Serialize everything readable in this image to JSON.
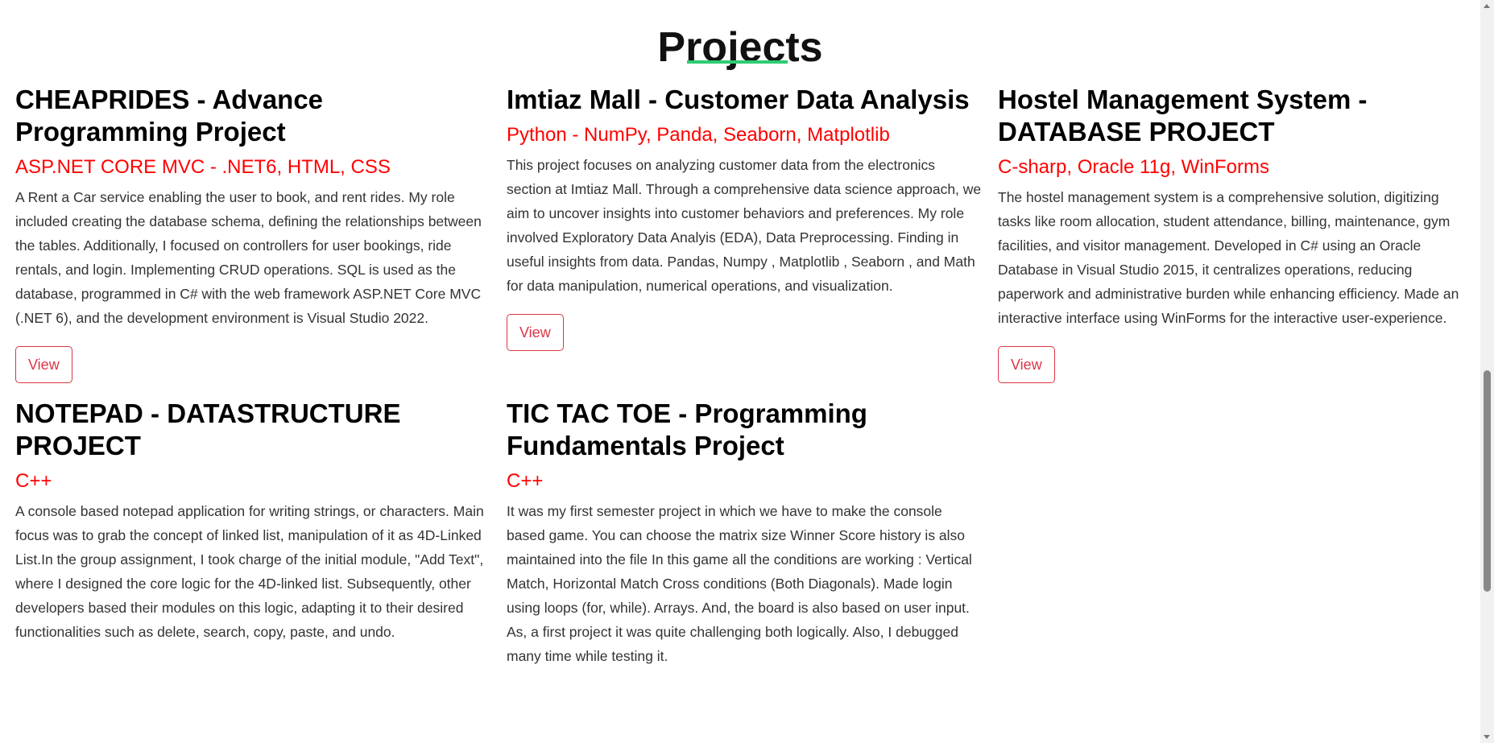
{
  "page": {
    "heading": "Projects",
    "accent_color": "#2ecc71",
    "tech_color": "#ff0000",
    "button_color": "#dc3545"
  },
  "projects": [
    {
      "title": "CHEAPRIDES - Advance Programming Project",
      "tech": "ASP.NET CORE MVC - .NET6, HTML, CSS",
      "description": "A Rent a Car service enabling the user to book, and rent rides. My role included creating the database schema, defining the relationships between the tables. Additionally, I focused on controllers for user bookings, ride rentals, and login. Implementing CRUD operations. SQL is used as the database, programmed in C# with the web framework ASP.NET Core MVC (.NET 6), and the development environment is Visual Studio 2022.",
      "button": "View"
    },
    {
      "title": "Imtiaz Mall - Customer Data Analysis",
      "tech": "Python - NumPy, Panda, Seaborn, Matplotlib",
      "description": "This project focuses on analyzing customer data from the electronics section at Imtiaz Mall. Through a comprehensive data science approach, we aim to uncover insights into customer behaviors and preferences. My role involved Exploratory Data Analyis (EDA), Data Preprocessing. Finding in useful insights from data. Pandas, Numpy , Matplotlib , Seaborn , and Math for data manipulation, numerical operations, and visualization.",
      "button": "View"
    },
    {
      "title": "Hostel Management System - DATABASE PROJECT",
      "tech": "C-sharp, Oracle 11g, WinForms",
      "description": "The hostel management system is a comprehensive solution, digitizing tasks like room allocation, student attendance, billing, maintenance, gym facilities, and visitor management. Developed in C# using an Oracle Database in Visual Studio 2015, it centralizes operations, reducing paperwork and administrative burden while enhancing efficiency. Made an interactive interface using WinForms for the interactive user-experience.",
      "button": "View"
    },
    {
      "title": "NOTEPAD - DATASTRUCTURE PROJECT",
      "tech": "C++",
      "description": "A console based notepad application for writing strings, or characters. Main focus was to grab the concept of linked list, manipulation of it as 4D-Linked List.In the group assignment, I took charge of the initial module, \"Add Text\", where I designed the core logic for the 4D-linked list. Subsequently, other developers based their modules on this logic, adapting it to their desired functionalities such as delete, search, copy, paste, and undo."
    },
    {
      "title": "TIC TAC TOE - Programming Fundamentals Project",
      "tech": "C++",
      "description": "It was my first semester project in which we have to make the console based game. You can choose the matrix size Winner Score history is also maintained into the file In this game all the conditions are working : Vertical Match, Horizontal Match Cross conditions (Both Diagonals). Made login using loops (for, while). Arrays. And, the board is also based on user input. As, a first project it was quite challenging both logically. Also, I debugged many time while testing it."
    }
  ]
}
